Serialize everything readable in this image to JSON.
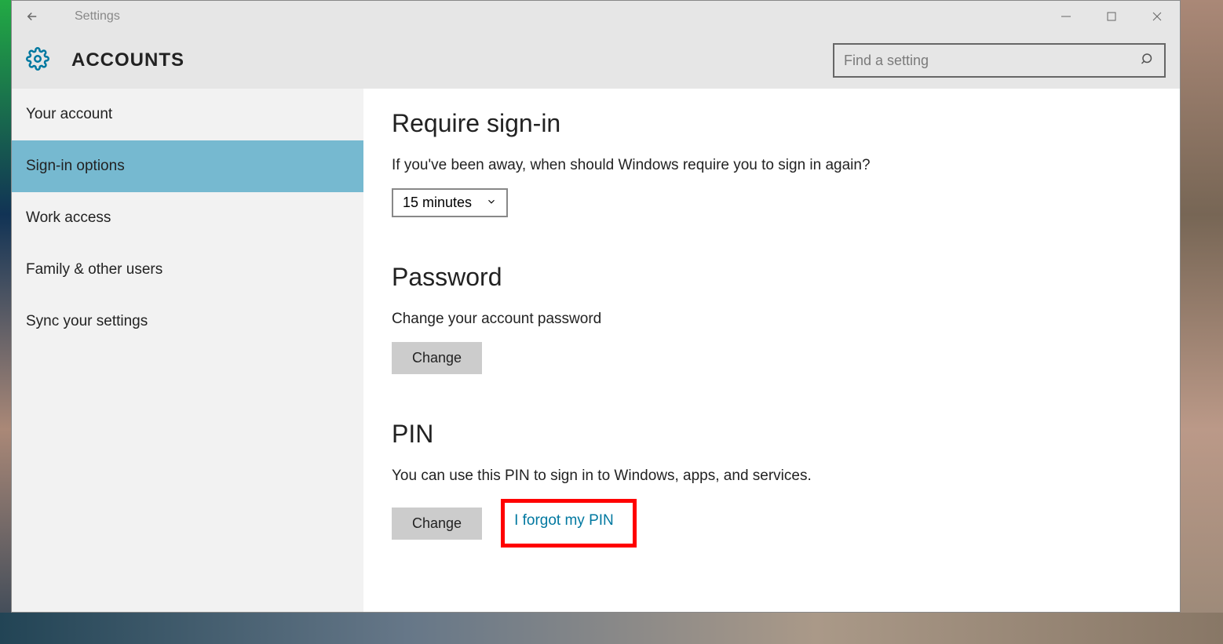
{
  "titlebar": {
    "title": "Settings"
  },
  "header": {
    "title": "ACCOUNTS",
    "search_placeholder": "Find a setting"
  },
  "sidebar": {
    "items": [
      {
        "label": "Your account",
        "active": false
      },
      {
        "label": "Sign-in options",
        "active": true
      },
      {
        "label": "Work access",
        "active": false
      },
      {
        "label": "Family & other users",
        "active": false
      },
      {
        "label": "Sync your settings",
        "active": false
      }
    ]
  },
  "main": {
    "require_signin": {
      "heading": "Require sign-in",
      "body": "If you've been away, when should Windows require you to sign in again?",
      "dropdown_value": "15 minutes"
    },
    "password": {
      "heading": "Password",
      "body": "Change your account password",
      "button": "Change"
    },
    "pin": {
      "heading": "PIN",
      "body": "You can use this PIN to sign in to Windows, apps, and services.",
      "button": "Change",
      "forgot_link": "I forgot my PIN"
    }
  }
}
